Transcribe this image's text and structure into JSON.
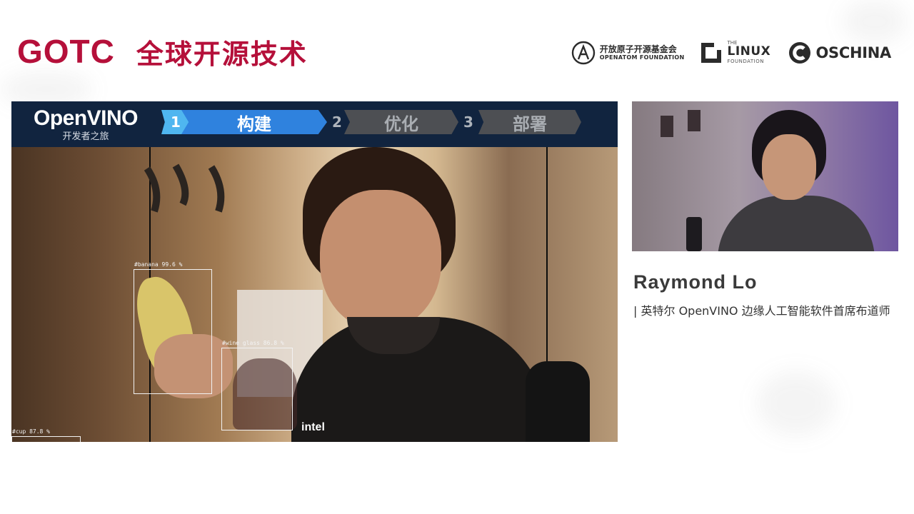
{
  "header": {
    "brand": "GOTC",
    "brand_cn": "全球开源技术",
    "logos": {
      "openatom_cn": "开放原子开源基金会",
      "openatom_en": "OPENATOM FOUNDATION",
      "linux_the": "THE",
      "linux_main": "LINUX",
      "linux_foundation": "FOUNDATION",
      "oschina": "OSCHINA"
    }
  },
  "slide": {
    "logo_name": "OpenVINO",
    "logo_sub": "开发者之旅",
    "steps": [
      {
        "num": "1",
        "label": "构建",
        "active": true
      },
      {
        "num": "2",
        "label": "优化",
        "active": false
      },
      {
        "num": "3",
        "label": "部署",
        "active": false
      }
    ],
    "detections": [
      {
        "label": "#banana 99.6 %"
      },
      {
        "label": "#wine glass 86.8 %"
      },
      {
        "label": "#cup 87.8 %"
      }
    ],
    "watermark": "intel"
  },
  "speaker": {
    "name": "Raymond Lo",
    "title": "| 英特尔 OpenVINO 边缘人工智能软件首席布道师"
  },
  "colors": {
    "brand_red": "#b5103a",
    "header_navy": "#11243f",
    "step_active": "#2f82de",
    "step_active_num": "#4fb6f0",
    "step_idle": "#4d4f53"
  }
}
